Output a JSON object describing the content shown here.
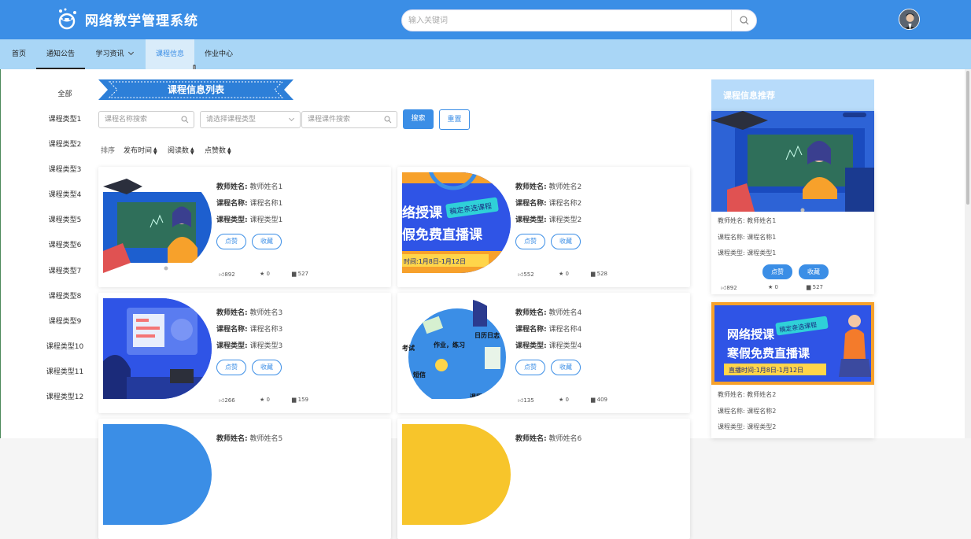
{
  "header": {
    "app_title": "网络教学管理系统",
    "search_placeholder": "输入关键词"
  },
  "nav": [
    "首页",
    "通知公告",
    "学习资讯",
    "课程信息",
    "作业中心"
  ],
  "nav_active": "课程信息",
  "sidebar": [
    "全部",
    "课程类型1",
    "课程类型2",
    "课程类型3",
    "课程类型4",
    "课程类型5",
    "课程类型6",
    "课程类型7",
    "课程类型8",
    "课程类型9",
    "课程类型10",
    "课程类型11",
    "课程类型12"
  ],
  "main": {
    "section_title": "课程信息列表",
    "filters": {
      "name_placeholder": "课程名称搜索",
      "type_placeholder": "请选择课程类型",
      "file_placeholder": "课程课件搜索",
      "search_label": "搜索",
      "reset_label": "重置"
    },
    "sort": {
      "label": "排序",
      "options": [
        "发布时间",
        "阅读数",
        "点赞数"
      ]
    }
  },
  "labels": {
    "teacher": "教师姓名:",
    "course": "课程名称:",
    "type": "课程类型:",
    "like": "点赞",
    "favorite": "收藏"
  },
  "courses": [
    {
      "teacher": "教师姓名1",
      "course": "课程名称1",
      "type": "课程类型1",
      "likes": "892",
      "stars": "0",
      "views": "527"
    },
    {
      "teacher": "教师姓名2",
      "course": "课程名称2",
      "type": "课程类型2",
      "likes": "552",
      "stars": "0",
      "views": "528"
    },
    {
      "teacher": "教师姓名3",
      "course": "课程名称3",
      "type": "课程类型3",
      "likes": "266",
      "stars": "0",
      "views": "159"
    },
    {
      "teacher": "教师姓名4",
      "course": "课程名称4",
      "type": "课程类型4",
      "likes": "135",
      "stars": "0",
      "views": "409"
    },
    {
      "teacher": "教师姓名5"
    },
    {
      "teacher": "教师姓名6"
    }
  ],
  "thumbs": {
    "promo_line1": "络授课",
    "promo_line2": "假免费直播课",
    "promo_tag": "稿定亲选课程",
    "promo_time": "时间:1月8日-1月12日",
    "tool_1": "日历日志",
    "tool_2": "作业，练习",
    "tool_3": "考试",
    "tool_4": "短信",
    "tool_5": "课程日"
  },
  "recommend": {
    "title": "课程信息推荐",
    "items": [
      {
        "teacher": "教师姓名1",
        "course": "课程名称1",
        "type": "课程类型1",
        "likes": "892",
        "stars": "0",
        "views": "527"
      },
      {
        "teacher": "教师姓名2",
        "course": "课程名称2",
        "type": "课程类型2"
      }
    ],
    "promo_line1": "网络授课",
    "promo_line2": "寒假免费直播课",
    "promo_tag": "稿定亲选课程",
    "promo_time": "直播时间:1月8日-1月12日"
  },
  "colors": {
    "primary": "#3b8ee6",
    "nav_bg": "#a9d6f6",
    "accent_orange": "#f7a12b"
  }
}
